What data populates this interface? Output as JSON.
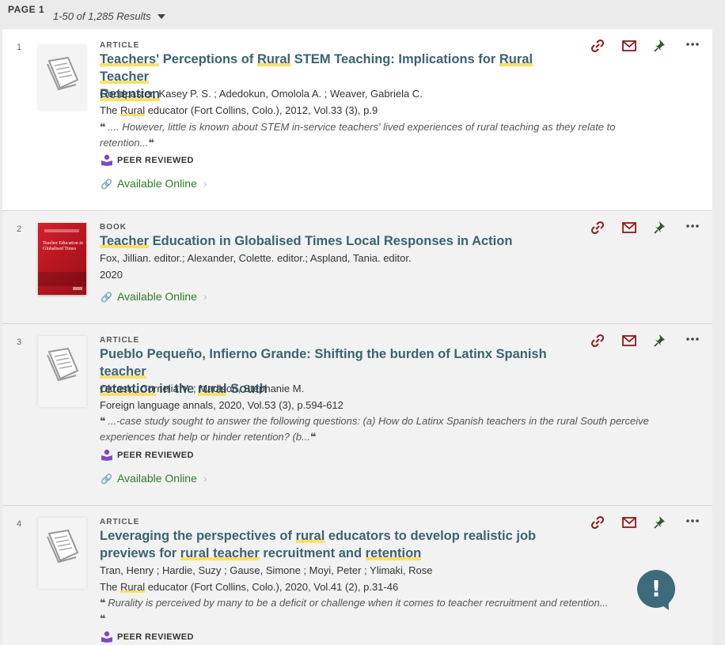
{
  "header": {
    "page_label": "PAGE 1",
    "results_count": "1-50 of 1,285 Results"
  },
  "colors": {
    "title": "#3c6270",
    "available": "#2f7a2b",
    "highlight": "#fde067",
    "action_icons": "#8b1a1a",
    "pin": "#2f5a2b"
  },
  "results": [
    {
      "number": "1",
      "type": "ARTICLE",
      "title_parts": [
        "Teachers'",
        " Perceptions of ",
        "Rural",
        " STEM Teaching: Implications for ",
        "Rural Teacher",
        " ",
        "Retention"
      ],
      "authors": "Goodpaster, Kasey P. S. ; Adedokun, Omolola A. ; Weaver, Gabriela C.",
      "source_pre": "The ",
      "source_hl": "Rural",
      "source_post": " educator (Fort Collins, Colo.), 2012, Vol.33 (3), p.9",
      "snippet": ".... However, little is known about STEM in-service teachers' lived experiences of rural teaching as they relate to retention...",
      "peer_reviewed": "PEER REVIEWED",
      "availability": "Available Online"
    },
    {
      "number": "2",
      "type": "BOOK",
      "title_parts": [
        "Teacher",
        " Education in Globalised Times Local Responses in Action"
      ],
      "authors": "Fox, Jillian. editor.; Alexander, Colette. editor.; Aspland, Tania. editor.",
      "year": "2020",
      "cover_title": "Teacher Education in Globalised Times",
      "availability": "Available Online"
    },
    {
      "number": "3",
      "type": "ARTICLE",
      "title_parts": [
        "Pueblo Pequeño, Infierno Grande: Shifting the burden of Latinx Spanish ",
        "teacher",
        " ",
        "retention",
        " in the ",
        "rural",
        " South"
      ],
      "authors": "Okraski, Cornelia V. ; Madison, Stephanie M.",
      "source": "Foreign language annals, 2020, Vol.53 (3), p.594-612",
      "snippet": "...-case study sought to answer the following questions: (a) How do Latinx Spanish teachers in the rural South perceive experiences that help or hinder retention? (b...",
      "peer_reviewed": "PEER REVIEWED",
      "availability": "Available Online"
    },
    {
      "number": "4",
      "type": "ARTICLE",
      "title_parts": [
        "Leveraging the perspectives of ",
        "rural",
        " educators to develop realistic job previews for ",
        "rural teacher",
        " recruitment and ",
        "retention"
      ],
      "authors": "Tran, Henry ; Hardie, Suzy ; Gause, Simone ; Moyi, Peter ; Ylimaki, Rose",
      "source_pre": "The ",
      "source_hl": "Rural",
      "source_post": " educator (Fort Collins, Colo.), 2020, Vol.41 (2), p.31-46",
      "snippet": "Rurality is perceived by many to be a deficit or challenge when it comes to teacher recruitment and retention...",
      "peer_reviewed": "PEER REVIEWED"
    }
  ],
  "help": {
    "glyph": "!"
  }
}
